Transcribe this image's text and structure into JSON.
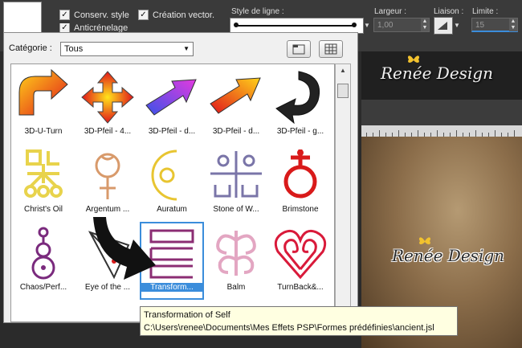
{
  "toolbar": {
    "checkbox_style": {
      "label": "Conserv. style",
      "checked": true
    },
    "checkbox_vector": {
      "label": "Création vector.",
      "checked": true
    },
    "checkbox_antialias": {
      "label": "Anticrénelage",
      "checked": true
    },
    "line_style_label": "Style de ligne :",
    "width_label": "Largeur :",
    "width_value": "1,00",
    "join_label": "Liaison :",
    "limit_label": "Limite :",
    "limit_value": "15"
  },
  "canvas": {
    "brand_text": "Renée Design"
  },
  "dialog": {
    "category_label": "Catégorie :",
    "category_value": "Tous",
    "items": [
      {
        "label": "3D-U-Turn",
        "icon": "3d-u-turn-arrow-icon"
      },
      {
        "label": "3D-Pfeil - 4...",
        "icon": "3d-four-way-arrow-icon"
      },
      {
        "label": "3D-Pfeil - d...",
        "icon": "3d-arrow-icon"
      },
      {
        "label": "3D-Pfeil - d...",
        "icon": "3d-arrow-icon"
      },
      {
        "label": "3D-Pfeil - g...",
        "icon": "3d-curved-arrow-icon"
      },
      {
        "label": "Christ's Oil",
        "icon": "alchemy-christs-oil-icon"
      },
      {
        "label": "Argentum ...",
        "icon": "alchemy-argentum-icon"
      },
      {
        "label": "Auratum",
        "icon": "alchemy-auratum-icon"
      },
      {
        "label": "Stone of W...",
        "icon": "alchemy-stone-icon"
      },
      {
        "label": "Brimstone",
        "icon": "alchemy-brimstone-icon"
      },
      {
        "label": "Chaos/Perf...",
        "icon": "alchemy-chaos-icon"
      },
      {
        "label": "Eye of the ...",
        "icon": "alchemy-eye-icon"
      },
      {
        "label": "Transform...",
        "icon": "alchemy-transformation-icon",
        "selected": true
      },
      {
        "label": "Balm",
        "icon": "alchemy-balm-icon"
      },
      {
        "label": "TurnBack&...",
        "icon": "turnback-heart-icon"
      }
    ]
  },
  "tooltip": {
    "title": "Transformation of Self",
    "path": "C:\\Users\\renee\\Documents\\Mes Effets PSP\\Formes prédéfinies\\ancient.jsl"
  },
  "colors": {
    "selection": "#3b8ddb",
    "tooltip_bg": "#ffffe1",
    "toolbar_bg": "#3a3a3a"
  }
}
